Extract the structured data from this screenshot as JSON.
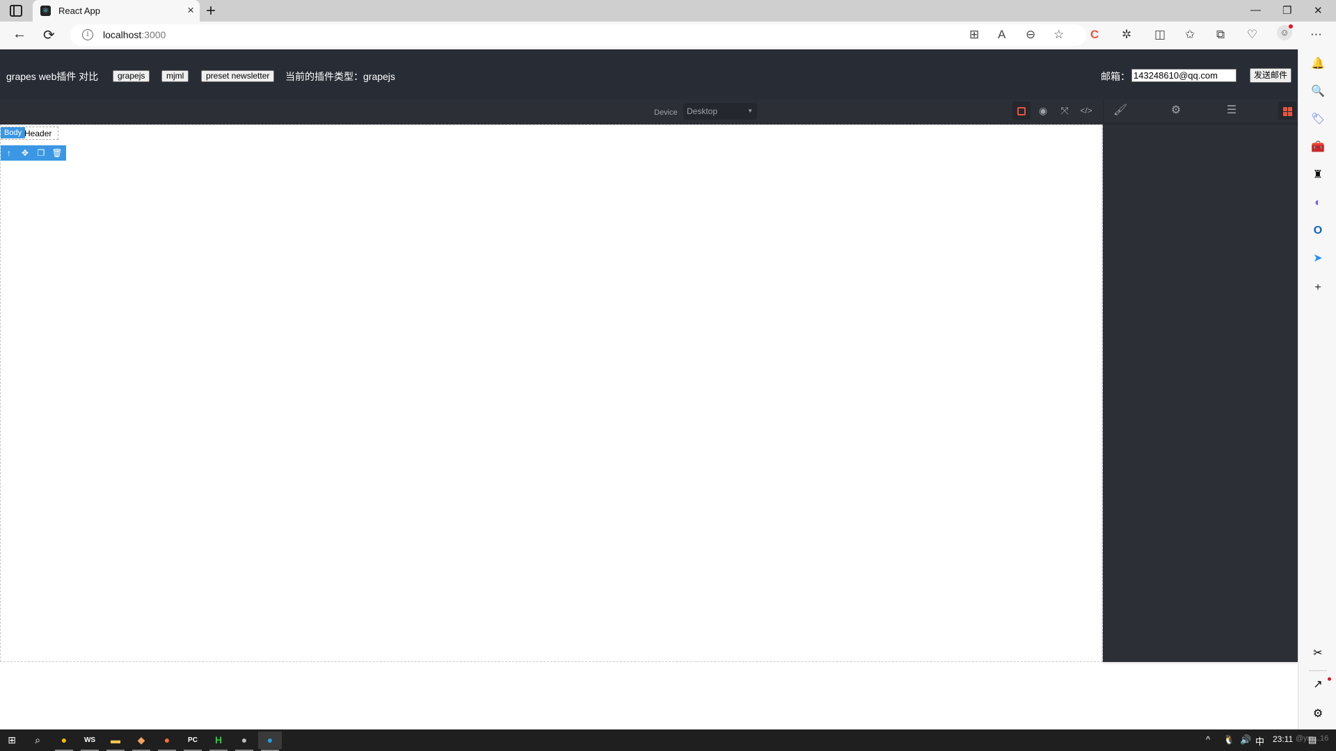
{
  "browser": {
    "tab_title": "React App",
    "tab_close": "×",
    "new_tab": "+",
    "window_controls": {
      "minimize": "—",
      "restore": "❐",
      "close": "✕"
    },
    "nav": {
      "back": "←",
      "refresh": "⟳"
    },
    "url_host": "localhost",
    "url_port": ":3000",
    "info_icon": "i",
    "toolbar_icons": [
      "app-available-icon",
      "read-aloud-icon",
      "zoom-out-icon",
      "favorite-icon",
      "extension-c-icon",
      "extensions-icon",
      "split-screen-icon",
      "favorites-icon",
      "collections-icon",
      "browser-essentials-icon",
      "profile-icon",
      "more-icon"
    ]
  },
  "header": {
    "brand": "grapes web插件 对比",
    "buttons": [
      "grapejs",
      "mjml",
      "preset newsletter"
    ],
    "current_type_label": "当前的插件类型：",
    "current_type_value": "grapejs",
    "email_label": "邮箱：",
    "email_value": "143248610@qq.com",
    "send_button": "发送邮件"
  },
  "editor": {
    "device_label": "Device",
    "device_selected": "Desktop",
    "options": [
      "sw-visibility",
      "preview",
      "fullscreen",
      "export-template"
    ],
    "panels": [
      "style-manager",
      "settings",
      "layer-manager",
      "blocks"
    ],
    "accent_color": "#e8553f",
    "selected_badge": "Body",
    "selected_element_text": "Header",
    "toolbar": [
      "select-parent",
      "move",
      "clone",
      "delete"
    ],
    "highlight_color": "#3b97e3"
  },
  "sidebar": {
    "items": [
      "notifications",
      "search",
      "shopping",
      "tools",
      "games",
      "microsoft-365",
      "outlook",
      "drop",
      "add"
    ],
    "bottom": [
      "screenshot",
      "open-external",
      "settings"
    ]
  },
  "taskbar": {
    "apps": [
      "start",
      "search",
      "chrome",
      "webstorm",
      "file-explorer",
      "git",
      "postman",
      "pycharm",
      "hbuilder",
      "app-round",
      "edge"
    ],
    "tray": {
      "chevron": "^",
      "ime": "中",
      "clock": "23:11",
      "watermark": "@ym...16"
    }
  }
}
